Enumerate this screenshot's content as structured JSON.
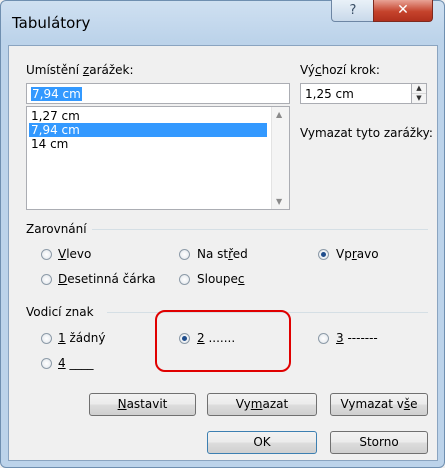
{
  "window": {
    "title": "Tabulátory",
    "help_icon": "?",
    "close_icon": "✕"
  },
  "tab_position": {
    "label_pre": "Umístění ",
    "label_u": "z",
    "label_post": "arážek:",
    "value": "7,94 cm",
    "list": [
      "1,27 cm",
      "7,94 cm",
      "14 cm"
    ],
    "selected_index": 1
  },
  "default_step": {
    "label_pre": "Vý",
    "label_u": "c",
    "label_post": "hozí krok:",
    "value": "1,25 cm"
  },
  "clear_label": "Vymazat tyto zarážky:",
  "alignment": {
    "title": "Zarovnání",
    "left_u": "V",
    "left_rest": "levo",
    "center_pre": "Na st",
    "center_u": "ř",
    "center_post": "ed",
    "right_pre": "Vp",
    "right_u": "r",
    "right_post": "avo",
    "decimal_u": "D",
    "decimal_rest": "esetinná čárka",
    "bar_pre": "Sloupe",
    "bar_u": "c",
    "selected": "right"
  },
  "leader": {
    "title": "Vodicí znak",
    "opt1_u": "1",
    "opt1_rest": " žádný",
    "opt2_u": "2",
    "opt2_rest": " .......",
    "opt3_u": "3",
    "opt3_rest": " -------",
    "opt4_u": "4",
    "opt4_rest": " ____",
    "selected": "2"
  },
  "buttons": {
    "set_u": "N",
    "set_rest": "astavit",
    "clear_pre": "Vy",
    "clear_u": "m",
    "clear_post": "azat",
    "clearall_pre": "Vymazat v",
    "clearall_u": "š",
    "clearall_post": "e",
    "ok": "OK",
    "cancel": "Storno"
  },
  "colors": {
    "selection": "#3399ff",
    "highlight": "#e00000"
  }
}
